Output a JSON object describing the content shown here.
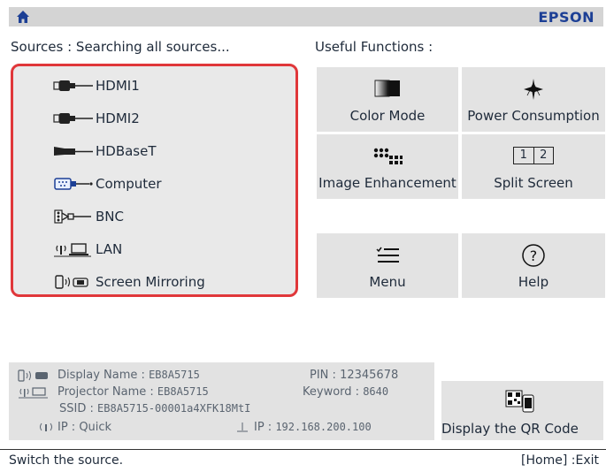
{
  "header": {
    "home_icon": "home-icon",
    "brand": "EPSON"
  },
  "sources": {
    "title": "Sources : Searching all sources...",
    "items": [
      {
        "label": "HDMI1",
        "icon": "hdmi-icon"
      },
      {
        "label": "HDMI2",
        "icon": "hdmi-icon"
      },
      {
        "label": "HDBaseT",
        "icon": "hdbaset-icon"
      },
      {
        "label": "Computer",
        "icon": "vga-icon"
      },
      {
        "label": "BNC",
        "icon": "bnc-icon"
      },
      {
        "label": "LAN",
        "icon": "lan-icon"
      },
      {
        "label": "Screen Mirroring",
        "icon": "screen-mirroring-icon"
      }
    ]
  },
  "functions": {
    "title": "Useful Functions :",
    "buttons": [
      {
        "label": "Color Mode",
        "icon": "color-mode-icon"
      },
      {
        "label": "Power Consumption",
        "icon": "power-consumption-icon"
      },
      {
        "label": "Image Enhancement",
        "icon": "image-enhancement-icon"
      },
      {
        "label": "Split Screen",
        "icon": "split-screen-icon"
      },
      {
        "label": "Menu",
        "icon": "menu-icon"
      },
      {
        "label": "Help",
        "icon": "help-icon"
      }
    ],
    "split_numbers": [
      "1",
      "2"
    ]
  },
  "network_info": {
    "display_name_label": "Display Name :",
    "display_name_value": "EB8A5715",
    "pin_label": "PIN :",
    "pin_value": "12345678",
    "projector_name_label": "Projector Name :",
    "projector_name_value": "EB8A5715",
    "keyword_label": "Keyword :",
    "keyword_value": "8640",
    "ssid_label": "SSID :",
    "ssid_value": "EB8A5715-00001a4XFK18MtI",
    "ip_mode_label": "IP :",
    "ip_mode_value": "Quick",
    "ip_label": "IP :",
    "ip_value": "192.168.200.100"
  },
  "qr_button": {
    "label": "Display the QR Code",
    "icon": "qr-code-icon"
  },
  "status_bar": {
    "hint": "Switch the source.",
    "exit_hint": "[Home] :Exit"
  },
  "colors": {
    "highlight_border": "#e0373a",
    "brand": "#1c3f95",
    "panel": "#e9e9e9"
  }
}
